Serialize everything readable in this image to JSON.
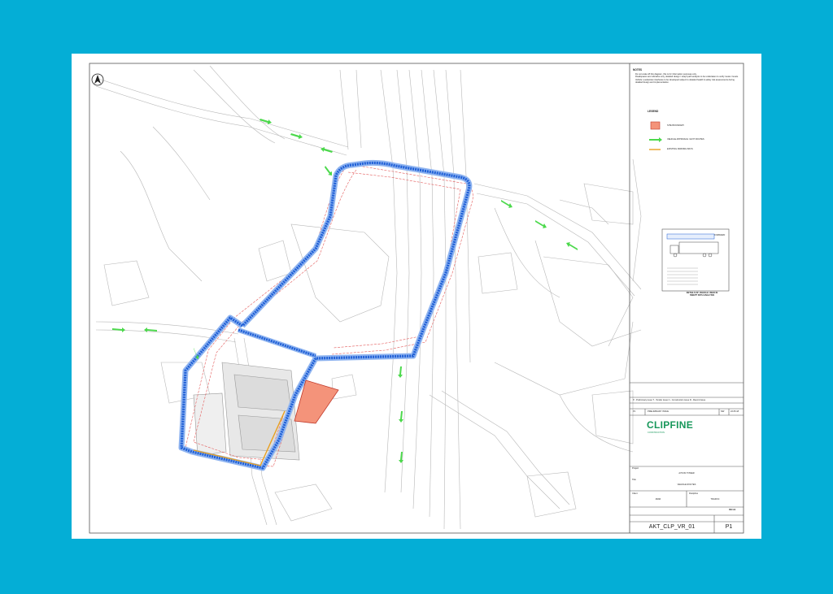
{
  "notes": {
    "heading": "NOTES",
    "items": [
      "Do not scale off this diagram, this is for information purposes only.",
      "Roadspaces are indicative only, detailed design / swept path analysis to be undertaken to verify routes / levels.",
      "Vehicle / pedestrian interfaces to be developed subject to detailed health & safety risk assessments during detailed design and implementation."
    ]
  },
  "legend": {
    "heading": "LEGEND",
    "items": [
      {
        "label": "SITE BOUNDARY",
        "color": "#f4937a"
      },
      {
        "label": "VEHICLE APPROACH / EXIT ROUTES",
        "color": "#4cd94c"
      },
      {
        "label": "EXISTING PARKING BAYS",
        "color": "#e8a020"
      }
    ]
  },
  "vehicle_detail": {
    "forward_label": "FORWARD",
    "caption_line1": "DETAILS OF VEHICLE USED IN",
    "caption_line2": "SWEPT PATH ANALYSIS"
  },
  "title_block": {
    "status_key": "P - Preliminary issue   T - Tender issue   C - Construction issue   R - Record issue",
    "rev_row": {
      "rev": "P1",
      "description": "PRELIMINARY ISSUE",
      "by": "NW",
      "date": "22.05.18"
    },
    "company_name": "CLIPFINE",
    "company_sub": "CONSTRUCTION",
    "project_label": "Project",
    "project": "AYKON TOWER",
    "title_label": "Title",
    "title": "VEHICLE ROUTES",
    "client_label": "Client",
    "client": "MHW",
    "discipline_label": "Discipline",
    "discipline": "TRAFFIC",
    "sheet_size": "ISO A1",
    "drawing_number": "AKT_CLP_VR_01",
    "revision": "P1"
  },
  "colors": {
    "background": "#04aed6",
    "route_blue": "#1f5fd6",
    "route_light": "#8fb4f0",
    "red_offset": "#e35b5b",
    "site_fill": "#f4937a",
    "site_stroke": "#c0392b",
    "green_arrow": "#4cd94c",
    "brand_green": "#17975a",
    "map_line": "#b8b8b8"
  },
  "icons": {
    "north": "north-arrow-icon",
    "vehicle": "truck-icon"
  }
}
